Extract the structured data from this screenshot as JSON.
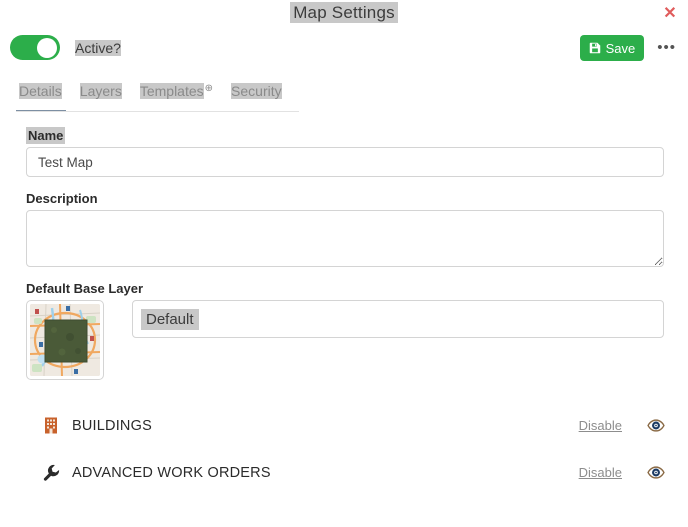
{
  "dialog": {
    "title": "Map Settings",
    "close_label": "✕"
  },
  "toolbar": {
    "active_toggle_label": "Active?",
    "active_toggle_state": "on",
    "save_label": "Save",
    "more_label": "•••"
  },
  "tabs": {
    "active": "Details",
    "items": [
      {
        "label": "Details",
        "has_globe": false
      },
      {
        "label": "Layers",
        "has_globe": false
      },
      {
        "label": "Templates",
        "has_globe": true
      },
      {
        "label": "Security",
        "has_globe": false
      }
    ],
    "globe_glyph": "⊕"
  },
  "form": {
    "name": {
      "label": "Name",
      "value": "Test Map",
      "placeholder": ""
    },
    "description": {
      "label": "Description",
      "value": "",
      "placeholder": ""
    },
    "base_layer": {
      "label": "Default Base Layer",
      "selected": "Default",
      "thumbnail_alt": "map-thumbnail"
    }
  },
  "layers": [
    {
      "name": "BUILDINGS",
      "icon": "building-icon",
      "icon_color": "#c8622c",
      "action_label": "Disable",
      "visibility_icon": "eye-icon"
    },
    {
      "name": "ADVANCED WORK ORDERS",
      "icon": "wrench-icon",
      "icon_color": "#2b2b2b",
      "action_label": "Disable",
      "visibility_icon": "eye-icon"
    }
  ],
  "colors": {
    "accent_green": "#2cae4a",
    "close_red": "#e05c5c",
    "tab_underline": "#7d8fa3",
    "selection_gray": "#c8c8c8"
  }
}
